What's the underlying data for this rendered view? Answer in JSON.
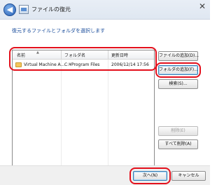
{
  "window": {
    "title": "ファイルの復元",
    "instruction": "復元するファイルとフォルダを選択します"
  },
  "list": {
    "columns": [
      "名前",
      "フォルダ名",
      "更新日時"
    ],
    "rows": [
      {
        "name": "Virtual Machine A...",
        "folder": "C:¥Program Files",
        "modified": "2006/12/14 17:56"
      }
    ]
  },
  "buttons": {
    "add_files": "ファイルの追加(D)...",
    "add_folder": "フォルダの追加(F)...",
    "search": "検索(S)...",
    "remove": "削除(E)",
    "remove_all": "すべて削除(A)",
    "next": "次へ(N)",
    "cancel": "キャンセル"
  },
  "annotation_color": "#e3101c"
}
